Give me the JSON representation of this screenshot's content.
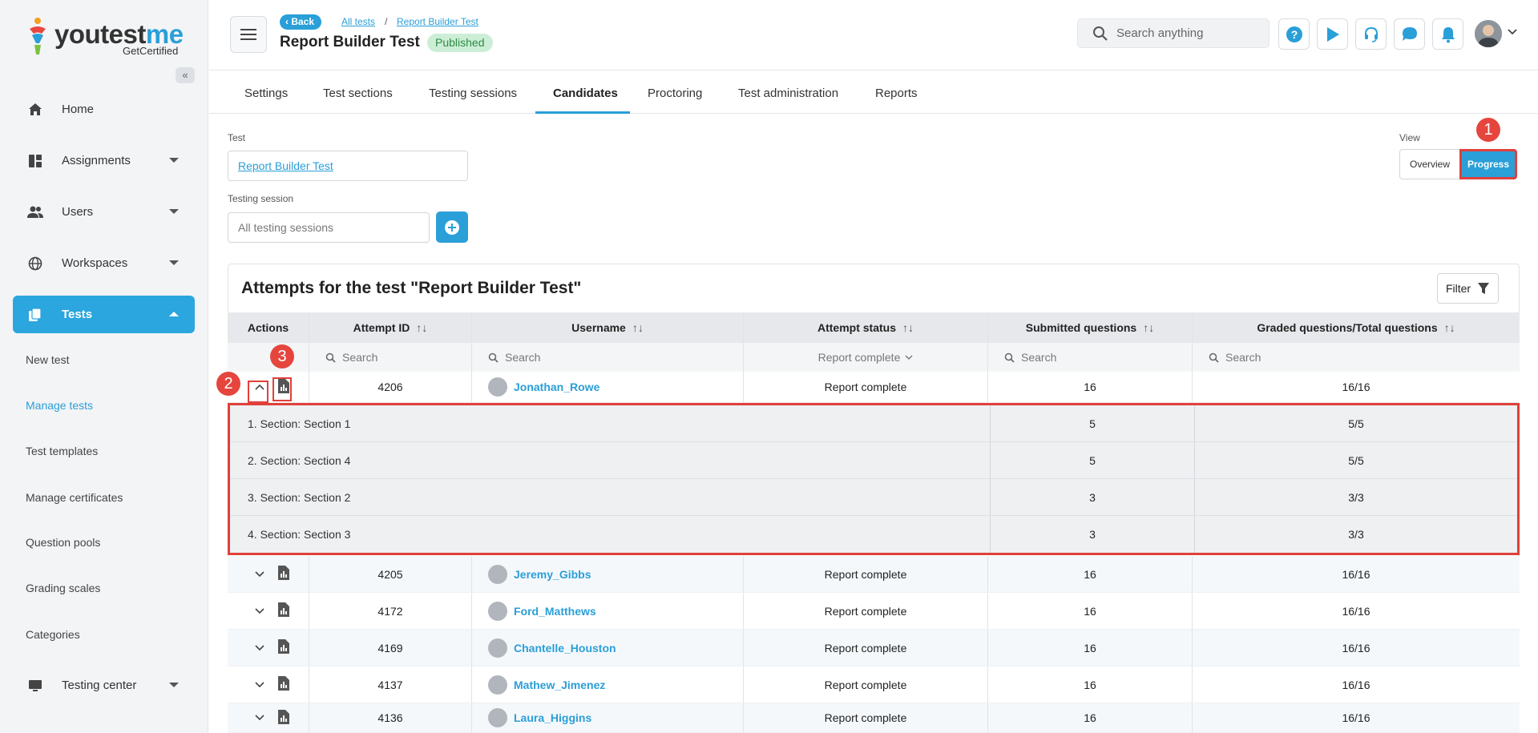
{
  "brand": {
    "name_part1": "youtest",
    "name_part2": "me",
    "tagline": "GetCertified"
  },
  "sidebar": {
    "collapse_label": "«",
    "items": [
      {
        "label": "Home",
        "icon": "home-icon"
      },
      {
        "label": "Assignments",
        "icon": "assignments-icon"
      },
      {
        "label": "Users",
        "icon": "users-icon"
      },
      {
        "label": "Workspaces",
        "icon": "globe-icon"
      },
      {
        "label": "Tests",
        "icon": "tests-icon"
      }
    ],
    "sub_items": [
      "New test",
      "Manage tests",
      "Test templates",
      "Manage certificates",
      "Question pools",
      "Grading scales",
      "Categories"
    ],
    "testing_center": "Testing center"
  },
  "header": {
    "back_label": "Back",
    "breadcrumb": [
      "All tests",
      "Report Builder Test"
    ],
    "breadcrumb_sep": "/",
    "title": "Report Builder Test",
    "status_badge": "Published",
    "search_placeholder": "Search anything"
  },
  "tabs": [
    "Settings",
    "Test sections",
    "Testing sessions",
    "Candidates",
    "Proctoring",
    "Test administration",
    "Reports"
  ],
  "form": {
    "test_label": "Test",
    "test_value": "Report Builder Test",
    "session_label": "Testing session",
    "session_placeholder": "All testing sessions",
    "view_label": "View",
    "view_overview": "Overview",
    "view_progress": "Progress"
  },
  "callouts": [
    "1",
    "2",
    "3"
  ],
  "table": {
    "title": "Attempts for the test \"Report Builder Test\"",
    "filter_label": "Filter",
    "columns": [
      "Actions",
      "Attempt ID",
      "Username",
      "Attempt status",
      "Submitted questions",
      "Graded questions/Total questions"
    ],
    "sort_glyph": "↑↓",
    "search_placeholder": "Search",
    "status_filter": "Report complete",
    "expanded_row": {
      "attempt_id": "4206",
      "username": "Jonathan_Rowe",
      "status": "Report complete",
      "submitted": "16",
      "graded": "16/16"
    },
    "sections": [
      {
        "name": "1. Section: Section 1",
        "submitted": "5",
        "graded": "5/5"
      },
      {
        "name": "2. Section: Section 4",
        "submitted": "5",
        "graded": "5/5"
      },
      {
        "name": "3. Section: Section 2",
        "submitted": "3",
        "graded": "3/3"
      },
      {
        "name": "4. Section: Section 3",
        "submitted": "3",
        "graded": "3/3"
      }
    ],
    "rows": [
      {
        "attempt_id": "4205",
        "username": "Jeremy_Gibbs",
        "status": "Report complete",
        "submitted": "16",
        "graded": "16/16"
      },
      {
        "attempt_id": "4172",
        "username": "Ford_Matthews",
        "status": "Report complete",
        "submitted": "16",
        "graded": "16/16"
      },
      {
        "attempt_id": "4169",
        "username": "Chantelle_Houston",
        "status": "Report complete",
        "submitted": "16",
        "graded": "16/16"
      },
      {
        "attempt_id": "4137",
        "username": "Mathew_Jimenez",
        "status": "Report complete",
        "submitted": "16",
        "graded": "16/16"
      },
      {
        "attempt_id": "4136",
        "username": "Laura_Higgins",
        "status": "Report complete",
        "submitted": "16",
        "graded": "16/16"
      }
    ]
  }
}
